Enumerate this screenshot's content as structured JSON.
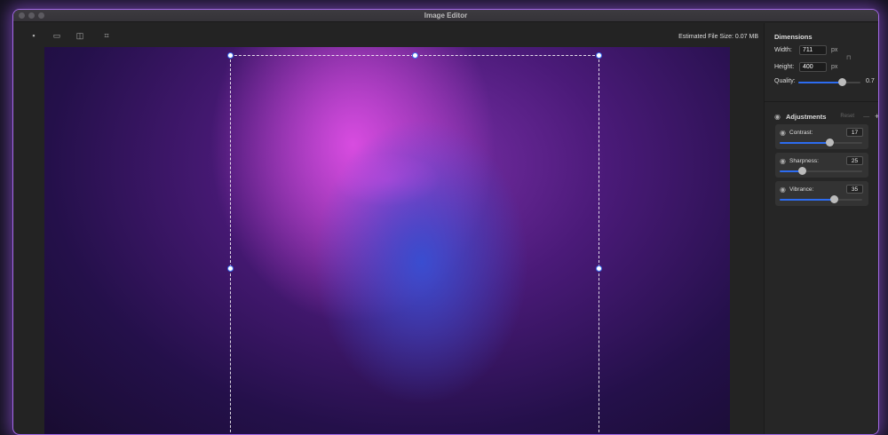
{
  "window": {
    "title": "Image Editor"
  },
  "toolbar": {
    "tools": [
      "layout-icon",
      "fit-width-icon",
      "split-icon",
      "crop-icon"
    ],
    "file_size_label": "Estimated File Size: 0.07 MB"
  },
  "dimensions": {
    "heading": "Dimensions",
    "width_label": "Width:",
    "width_value": "711",
    "height_label": "Height:",
    "height_value": "400",
    "unit": "px",
    "quality_label": "Quality:",
    "quality_value": "0.7",
    "quality_fraction": 0.7
  },
  "adjustments": {
    "heading": "Adjustments",
    "reset_label": "Reset",
    "minus": "—",
    "plus": "+",
    "items": [
      {
        "label": "Contrast:",
        "value": "17",
        "slider_fraction": 0.6
      },
      {
        "label": "Sharpness:",
        "value": "25",
        "slider_fraction": 0.27
      },
      {
        "label": "Vibrance:",
        "value": "35",
        "slider_fraction": 0.66
      }
    ]
  },
  "colors": {
    "accent": "#2d6cf0",
    "glow": "#a569e8"
  }
}
